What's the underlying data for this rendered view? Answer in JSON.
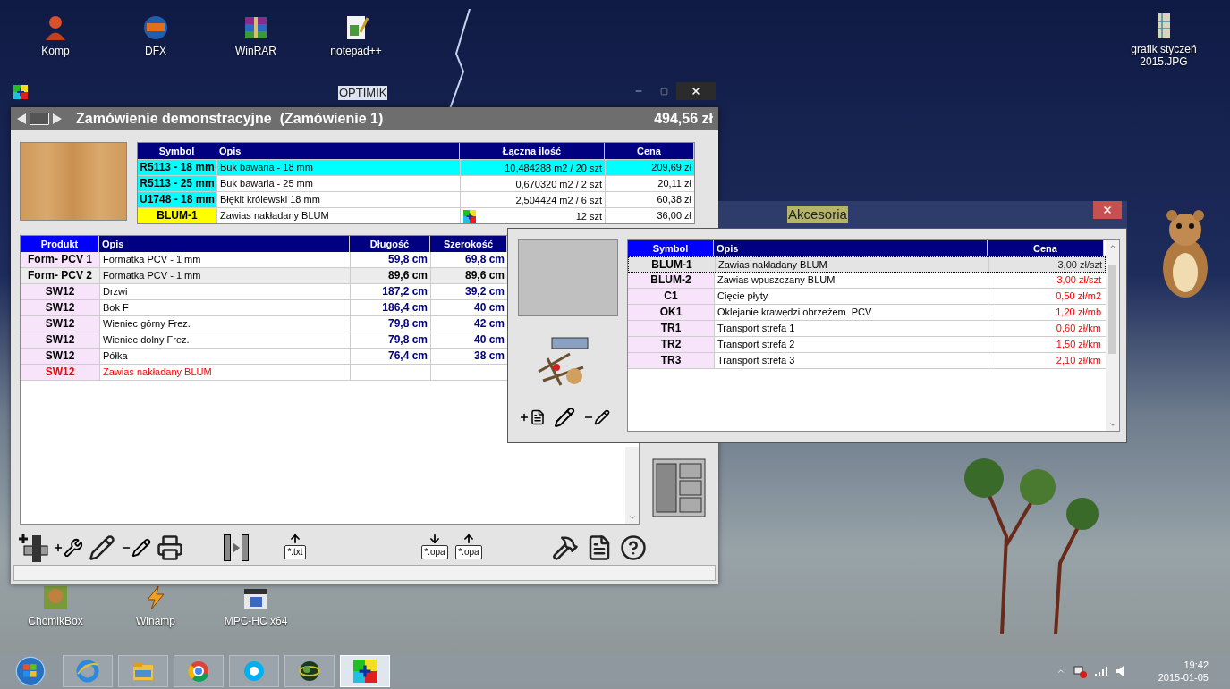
{
  "desktop": {
    "icons": [
      {
        "label": "Komp",
        "kind": "person"
      },
      {
        "label": "DFX",
        "kind": "disc"
      },
      {
        "label": "WinRAR",
        "kind": "books"
      },
      {
        "label": "notepad++",
        "kind": "notepad"
      }
    ],
    "right_icons": [
      {
        "label": "grafik styczeń 2015.JPG",
        "kind": "image"
      }
    ],
    "bottom_icons": [
      {
        "label": "ChomikBox",
        "kind": "box"
      },
      {
        "label": "Winamp",
        "kind": "bolt"
      },
      {
        "label": "MPC-HC x64",
        "kind": "film"
      }
    ],
    "partial_label": "OPTIMIK"
  },
  "main_window": {
    "title": "Zamówienie demonstracyjne  (Zamówienie 1)",
    "total": "494,56 zł",
    "materials": {
      "columns": [
        {
          "label": "Symbol",
          "sorted": false
        },
        {
          "label": "Opis",
          "sorted": false
        },
        {
          "label": "Łączna ilość",
          "sorted": false
        },
        {
          "label": "Cena",
          "sorted": false
        }
      ],
      "rows": [
        {
          "symbol": "R5113 - 18 mm",
          "description": "Buk bawaria - 18 mm",
          "quantity": "10,484288 m2 / 20 szt",
          "price": "209,69 zł",
          "kind": "board",
          "selected": true
        },
        {
          "symbol": "R5113 - 25 mm",
          "description": "Buk bawaria - 25 mm",
          "quantity": "0,670320 m2 / 2 szt",
          "price": "20,11 zł",
          "kind": "board",
          "selected": false
        },
        {
          "symbol": "U1748 - 18 mm",
          "description": "Błękit królewski 18 mm",
          "quantity": "2,504424 m2 / 6 szt",
          "price": "60,38 zł",
          "kind": "board",
          "selected": false
        },
        {
          "symbol": "BLUM-1",
          "description": "Zawias nakładany BLUM",
          "quantity": "12 szt",
          "price": "36,00 zł",
          "kind": "accessory",
          "selected": false
        }
      ]
    },
    "parts": {
      "columns": [
        {
          "label": "Produkt",
          "sorted": true
        },
        {
          "label": "Opis",
          "sorted": false
        },
        {
          "label": "Długość",
          "sorted": false
        },
        {
          "label": "Szerokość",
          "sorted": false
        }
      ],
      "rows": [
        {
          "product": "Form- PCV 1",
          "description": "Formatka PCV - 1 mm",
          "length": "59,8 cm",
          "width": "69,8 cm",
          "kind": "part",
          "selected": false
        },
        {
          "product": "Form- PCV 2",
          "description": "Formatka PCV - 1 mm",
          "length": "89,6 cm",
          "width": "89,6 cm",
          "kind": "part",
          "selected": true
        },
        {
          "product": "SW12",
          "description": "Drzwi",
          "length": "187,2 cm",
          "width": "39,2 cm",
          "kind": "part",
          "selected": false
        },
        {
          "product": "SW12",
          "description": "Bok F",
          "length": "186,4 cm",
          "width": "40 cm",
          "kind": "part",
          "selected": false
        },
        {
          "product": "SW12",
          "description": "Wieniec górny Frez.",
          "length": "79,8 cm",
          "width": "42 cm",
          "kind": "part",
          "selected": false
        },
        {
          "product": "SW12",
          "description": "Wieniec dolny Frez.",
          "length": "79,8 cm",
          "width": "40 cm",
          "kind": "part",
          "selected": false
        },
        {
          "product": "SW12",
          "description": "Półka",
          "length": "76,4 cm",
          "width": "38 cm",
          "kind": "part",
          "selected": false
        },
        {
          "product": "SW12",
          "description": "Zawias nakładany BLUM",
          "length": "",
          "width": "",
          "kind": "accessory",
          "selected": false
        }
      ]
    },
    "toolbar": [
      [
        {
          "kind": "add-board"
        },
        {
          "kind": "add-screw"
        },
        {
          "kind": "edit"
        },
        {
          "kind": "remove"
        },
        {
          "kind": "print"
        }
      ],
      [
        {
          "kind": "split"
        }
      ],
      [
        {
          "kind": "export",
          "label": "*.txt"
        }
      ],
      [
        {
          "kind": "import",
          "label": "*.opa"
        },
        {
          "kind": "export",
          "label": "*.opa"
        }
      ],
      [
        {
          "kind": "tools"
        },
        {
          "kind": "document"
        },
        {
          "kind": "help"
        }
      ]
    ]
  },
  "accessories_window": {
    "title": "Akcesoria",
    "columns": [
      {
        "label": "Symbol",
        "sorted": true
      },
      {
        "label": "Opis",
        "sorted": false
      },
      {
        "label": "Cena",
        "sorted": false
      }
    ],
    "rows": [
      {
        "symbol": "BLUM-1",
        "description": "Zawias nakładany BLUM",
        "price": "3,00 zł/szt",
        "selected": true
      },
      {
        "symbol": "BLUM-2",
        "description": "Zawias wpuszczany BLUM",
        "price": "3,00 zł/szt",
        "selected": false
      },
      {
        "symbol": "C1",
        "description": "Cięcie płyty",
        "price": "0,50 zł/m2",
        "selected": false
      },
      {
        "symbol": "OK1",
        "description": "Oklejanie krawędzi obrzeżem  PCV",
        "price": "1,20 zł/mb",
        "selected": false
      },
      {
        "symbol": "TR1",
        "description": "Transport strefa 1",
        "price": "0,60 zł/km",
        "selected": false
      },
      {
        "symbol": "TR2",
        "description": "Transport strefa 2",
        "price": "1,50 zł/km",
        "selected": false
      },
      {
        "symbol": "TR3",
        "description": "Transport strefa 3",
        "price": "2,10 zł/km",
        "selected": false
      }
    ]
  },
  "taskbar": {
    "apps": [
      {
        "kind": "start",
        "selected": false
      },
      {
        "kind": "browser-e",
        "selected": false
      },
      {
        "kind": "folder",
        "selected": false
      },
      {
        "kind": "browser-ring",
        "selected": false
      },
      {
        "kind": "chat",
        "selected": false
      },
      {
        "kind": "globe",
        "selected": false
      },
      {
        "kind": "grid",
        "selected": true
      }
    ],
    "time": "19:42",
    "date": "2015-01-05"
  }
}
